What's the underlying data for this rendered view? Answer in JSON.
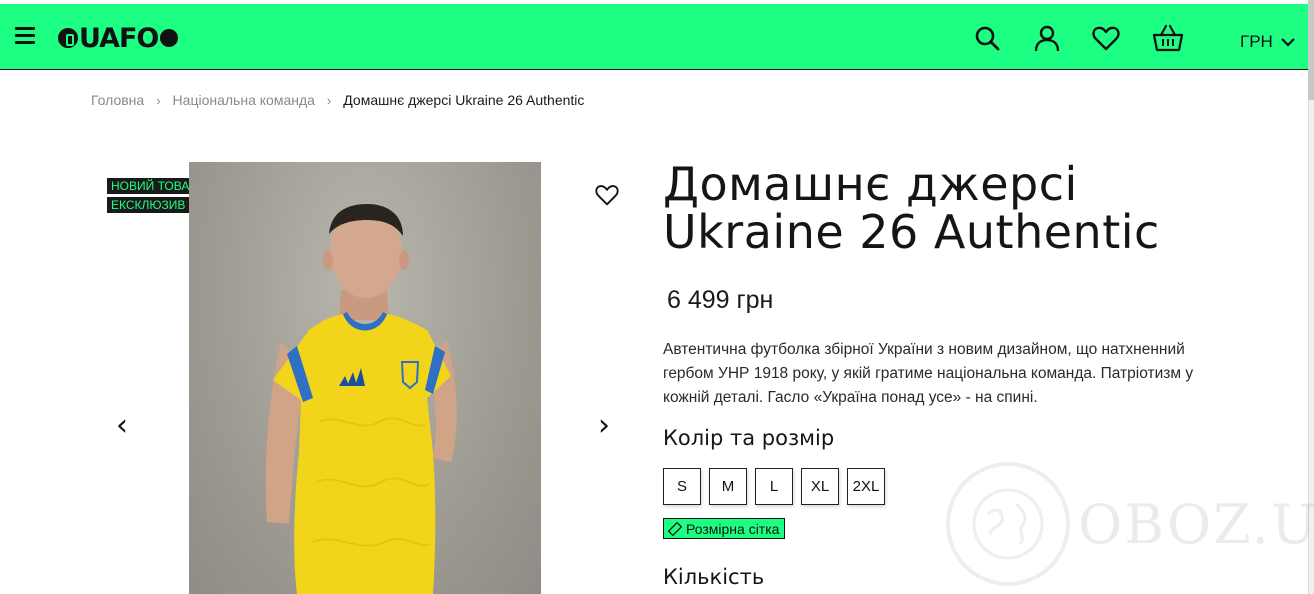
{
  "header": {
    "logo_text": "UAFO",
    "currency": "ГРН",
    "icons": [
      "menu-icon",
      "search-icon",
      "user-icon",
      "heart-icon",
      "basket-icon",
      "chevron-down-icon"
    ],
    "background_color": "#1dff82"
  },
  "breadcrumb": {
    "items": [
      "Головна",
      "Національна команда"
    ],
    "current": "Домашнє джерсі Ukraine 26 Authentic"
  },
  "gallery": {
    "badges": [
      "НОВИЙ ТОВАР",
      "ЕКСКЛЮЗИВ"
    ],
    "prev_arrow": "‹",
    "next_arrow": "›"
  },
  "product": {
    "title_line1": "Домашнє джерсі",
    "title_line2": "Ukraine 26 Authentic",
    "price": "6 499 грн",
    "description": "Автентична футболка збірної України з новим дизайном, що натхненний гербом УНР 1918 року, у якій гратиме національна команда. Патріотизм у кожній деталі. Гасло «Україна понад усе» - на спині.",
    "color_size_title": "Колір та розмір",
    "sizes": [
      "S",
      "M",
      "L",
      "XL",
      "2XL"
    ],
    "size_guide_label": "Розмірна сітка",
    "quantity_title": "Кількість"
  },
  "watermark": {
    "text": "OBOZ.UA"
  }
}
